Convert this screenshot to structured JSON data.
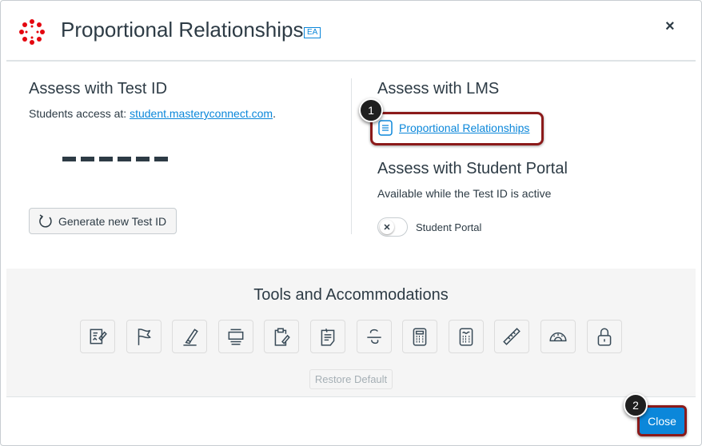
{
  "header": {
    "title": "Proportional Relationships",
    "badge": "EA",
    "close_icon": "×"
  },
  "test_id": {
    "heading": "Assess with Test ID",
    "access_prefix": "Students access at: ",
    "access_link": "student.masteryconnect.com",
    "access_suffix": ".",
    "generate_label": "Generate new Test ID"
  },
  "lms": {
    "heading": "Assess with LMS",
    "link": "Proportional Relationships"
  },
  "portal": {
    "heading": "Assess with Student Portal",
    "note": "Available while the Test ID is active",
    "toggle_label": "Student Portal",
    "toggle_on": false
  },
  "tools": {
    "heading": "Tools and Accommodations",
    "icons": [
      "notepad-pencil-icon",
      "flag-icon",
      "highlighter-icon",
      "line-reader-icon",
      "clipboard-pencil-icon",
      "sticky-note-icon",
      "strikethrough-icon",
      "calculator-icon",
      "graphing-calculator-icon",
      "ruler-icon",
      "protractor-icon",
      "lock-icon"
    ],
    "restore_label": "Restore Default"
  },
  "footer": {
    "close_label": "Close"
  },
  "callouts": [
    "1",
    "2"
  ],
  "colors": {
    "accent": "#0b87da",
    "highlight": "#8b1a1a",
    "logo": "#e4060f"
  }
}
